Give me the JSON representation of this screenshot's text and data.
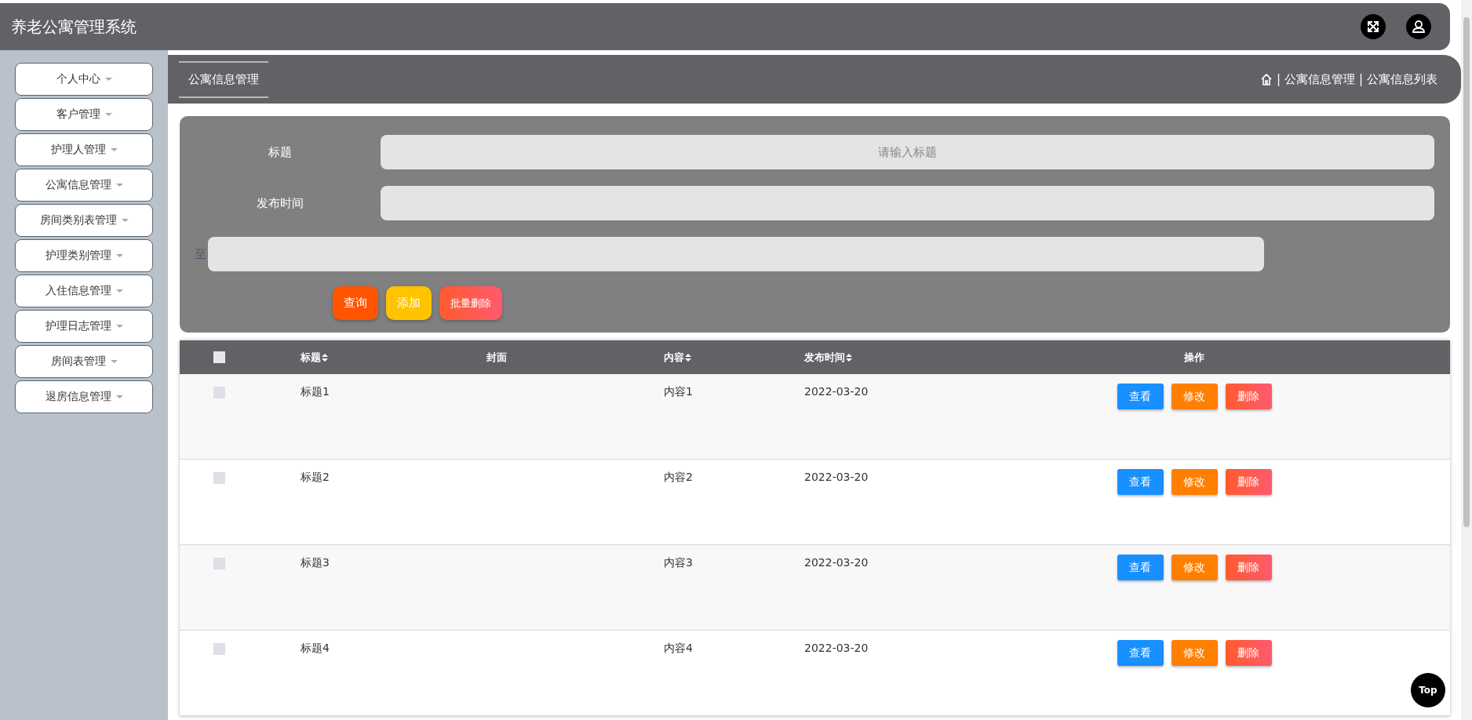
{
  "header": {
    "title": "养老公寓管理系统"
  },
  "sidebar": {
    "items": [
      {
        "label": "个人中心"
      },
      {
        "label": "客户管理"
      },
      {
        "label": "护理人管理"
      },
      {
        "label": "公寓信息管理"
      },
      {
        "label": "房间类别表管理"
      },
      {
        "label": "护理类别管理"
      },
      {
        "label": "入住信息管理"
      },
      {
        "label": "护理日志管理"
      },
      {
        "label": "房间表管理"
      },
      {
        "label": "退房信息管理"
      }
    ]
  },
  "breadcrumb": {
    "tab": "公寓信息管理",
    "separator": "|",
    "path": [
      "公寓信息管理",
      "公寓信息列表"
    ]
  },
  "search": {
    "fields": [
      {
        "label": "标题",
        "placeholder": "请输入标题"
      },
      {
        "label": "发布时间"
      }
    ],
    "range_label": "至",
    "buttons": [
      {
        "label": "查询",
        "kind": "query"
      },
      {
        "label": "添加",
        "kind": "add"
      },
      {
        "label": "批量删除",
        "kind": "batch-delete"
      }
    ]
  },
  "table": {
    "select_all": {
      "checked": false
    },
    "columns": [
      {
        "label": "标题",
        "sortable": true
      },
      {
        "label": "封面",
        "sortable": false
      },
      {
        "label": "内容",
        "sortable": true
      },
      {
        "label": "发布时间",
        "sortable": true
      },
      {
        "label": "操作",
        "sortable": false
      }
    ],
    "rows": [
      {
        "checked": false,
        "title": "标题1",
        "content": "内容1",
        "date": "2022-03-20",
        "actions": [
          {
            "label": "查看",
            "kind": "view"
          },
          {
            "label": "修改",
            "kind": "edit"
          },
          {
            "label": "删除",
            "kind": "delete"
          }
        ]
      },
      {
        "checked": false,
        "title": "标题2",
        "content": "内容2",
        "date": "2022-03-20",
        "actions": [
          {
            "label": "查看",
            "kind": "view"
          },
          {
            "label": "修改",
            "kind": "edit"
          },
          {
            "label": "删除",
            "kind": "delete"
          }
        ]
      },
      {
        "checked": false,
        "title": "标题3",
        "content": "内容3",
        "date": "2022-03-20",
        "actions": [
          {
            "label": "查看",
            "kind": "view"
          },
          {
            "label": "修改",
            "kind": "edit"
          },
          {
            "label": "删除",
            "kind": "delete"
          }
        ]
      },
      {
        "checked": false,
        "title": "标题4",
        "content": "内容4",
        "date": "2022-03-20",
        "actions": [
          {
            "label": "查看",
            "kind": "view"
          },
          {
            "label": "修改",
            "kind": "edit"
          },
          {
            "label": "删除",
            "kind": "delete"
          }
        ]
      }
    ]
  },
  "back_to_top": {
    "label": "Top"
  }
}
